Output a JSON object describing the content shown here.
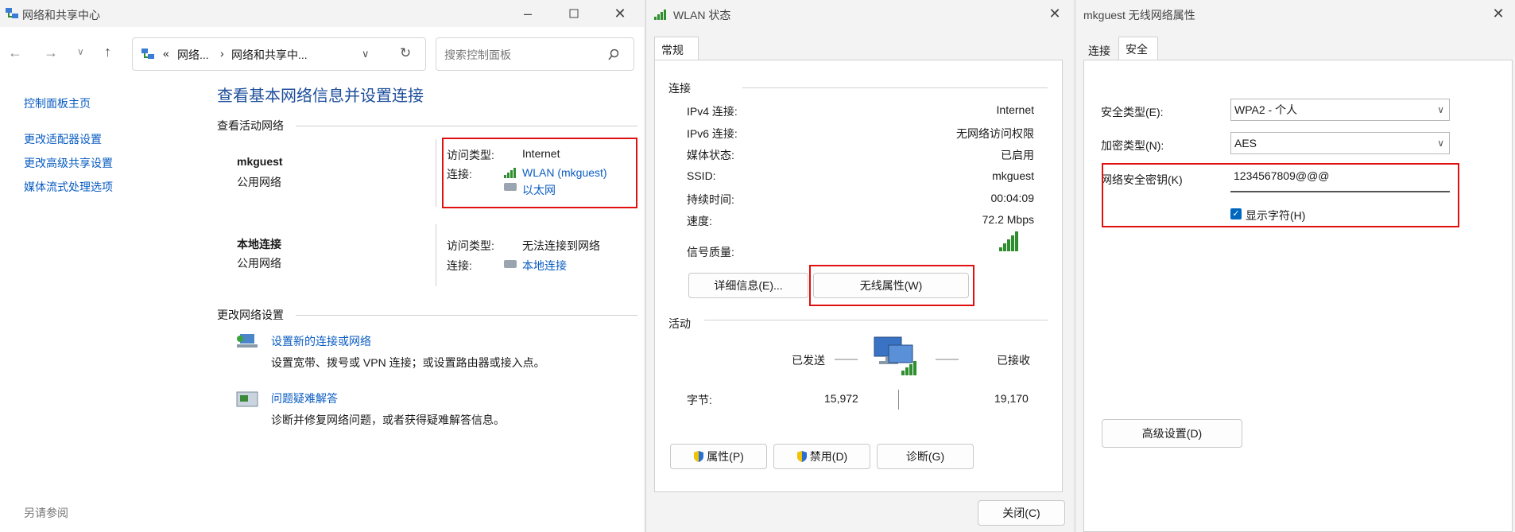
{
  "w1": {
    "title": "网络和共享中心",
    "breadcrumb": {
      "overflow": "«",
      "item1": "网络...",
      "arrow": "›",
      "item2": "网络和共享中..."
    },
    "search_placeholder": "搜索控制面板",
    "sidebar": {
      "home": "控制面板主页",
      "items": [
        "更改适配器设置",
        "更改高级共享设置",
        "媒体流式处理选项"
      ],
      "see_also": "另请参阅"
    },
    "heading": "查看基本网络信息并设置连接",
    "active_label": "查看活动网络",
    "networks": [
      {
        "name": "mkguest",
        "type": "公用网络",
        "access_label": "访问类型:",
        "access": "Internet",
        "conn_label": "连接:",
        "conn": "WLAN (mkguest)",
        "conn2": "以太网"
      },
      {
        "name": "本地连接",
        "type": "公用网络",
        "access_label": "访问类型:",
        "access": "无法连接到网络",
        "conn_label": "连接:",
        "conn": "本地连接"
      }
    ],
    "change_label": "更改网络设置",
    "tasks": [
      {
        "title": "设置新的连接或网络",
        "desc": "设置宽带、拨号或 VPN 连接；或设置路由器或接入点。"
      },
      {
        "title": "问题疑难解答",
        "desc": "诊断并修复网络问题，或者获得疑难解答信息。"
      }
    ]
  },
  "w2": {
    "title": "WLAN 状态",
    "tab": "常规",
    "section_conn": "连接",
    "rows": [
      {
        "label": "IPv4 连接:",
        "value": "Internet"
      },
      {
        "label": "IPv6 连接:",
        "value": "无网络访问权限"
      },
      {
        "label": "媒体状态:",
        "value": "已启用"
      },
      {
        "label": "SSID:",
        "value": "mkguest"
      },
      {
        "label": "持续时间:",
        "value": "00:04:09"
      },
      {
        "label": "速度:",
        "value": "72.2 Mbps"
      }
    ],
    "signal_label": "信号质量:",
    "btn_details": "详细信息(E)...",
    "btn_wireless": "无线属性(W)",
    "section_activity": "活动",
    "sent_label": "已发送",
    "recv_label": "已接收",
    "bytes_label": "字节:",
    "bytes_sent": "15,972",
    "bytes_recv": "19,170",
    "btn_props": "属性(P)",
    "btn_disable": "禁用(D)",
    "btn_diagnose": "诊断(G)",
    "btn_close": "关闭(C)"
  },
  "w3": {
    "title": "mkguest 无线网络属性",
    "tabs": [
      "连接",
      "安全"
    ],
    "sec_type_label": "安全类型(E):",
    "sec_type": "WPA2 - 个人",
    "enc_type_label": "加密类型(N):",
    "enc_type": "AES",
    "key_label": "网络安全密钥(K)",
    "key_value": "1234567809@@@",
    "show_chars": "显示字符(H)",
    "btn_advanced": "高级设置(D)"
  },
  "colors": {
    "link": "#0a5cc2",
    "heading": "#1e4f9c",
    "highlight": "#e01010",
    "signal": "#2f8f2f",
    "accent": "#0067c0"
  }
}
